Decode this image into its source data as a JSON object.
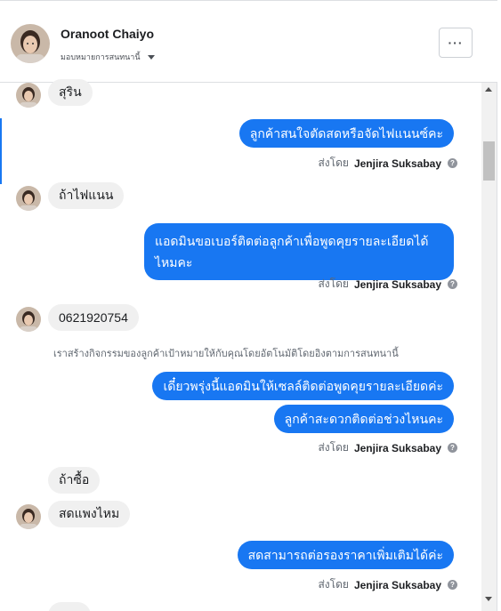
{
  "header": {
    "contact_name": "Oranoot Chaiyo",
    "assign_label": "มอบหมายการสนทนานี้",
    "more_label": "···"
  },
  "colors": {
    "outgoing_bubble": "#1877f2",
    "incoming_bubble": "#f0f0f0"
  },
  "messages": {
    "m1": "สุริน",
    "m2": "ลูกค้าสนใจตัดสดหรือจัดไฟแนนซ์คะ",
    "m3": "ถ้าไฟแนน",
    "m4": "แอดมินขอเบอร์ติดต่อลูกค้าเพื่อพูดคุยรายละเอียดได้ไหมคะ",
    "m5": "0621920754",
    "m6": "เดี๋ยวพรุ่งนี้แอดมินให้เซลล์ติดต่อพูดคุยรายละเอียดค่ะ",
    "m7": "ลูกค้าสะดวกติดต่อช่วงไหนคะ",
    "m8": "ถ้าซื้อ",
    "m9": "สดแพงไหม",
    "m10": "สดสามารถต่อรองราคาเพิ่มเติมได้ค่ะ"
  },
  "system_notice": "เราสร้างกิจกรรมของลูกค้าเป้าหมายให้กับคุณโดยอัตโนมัติโดยอิงตามการสนทนานี้",
  "sent_by": {
    "prefix": "ส่งโดย",
    "name": "Jenjira Suksabay",
    "help_glyph": "?"
  }
}
